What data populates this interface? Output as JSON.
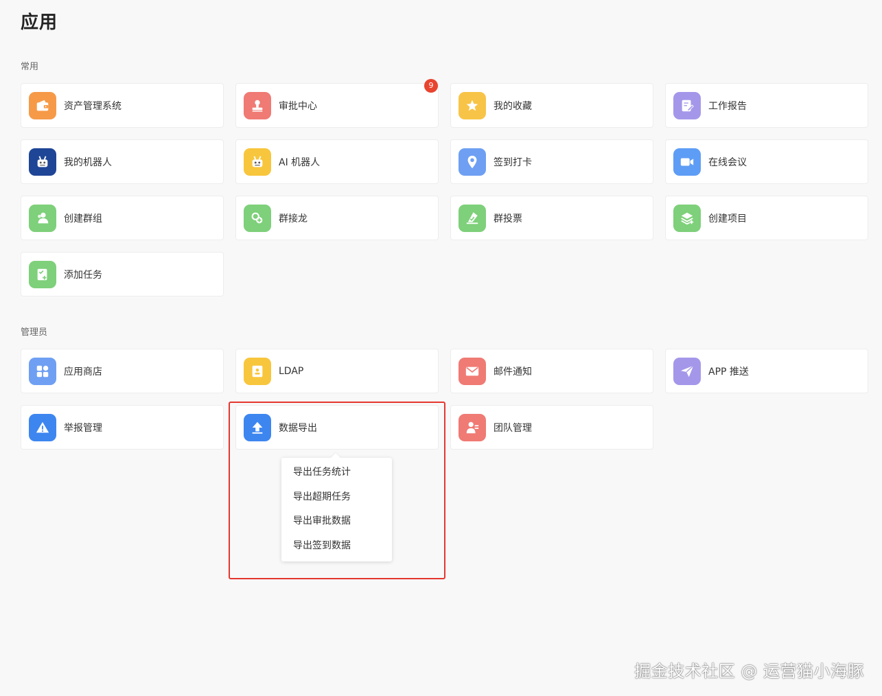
{
  "page": {
    "title": "应用"
  },
  "sections": {
    "common": {
      "label": "常用"
    },
    "admin": {
      "label": "管理员"
    }
  },
  "common_apps": [
    {
      "label": "资产管理系统",
      "icon": "wallet-icon",
      "color": "#f69a48"
    },
    {
      "label": "审批中心",
      "icon": "stamp-icon",
      "color": "#f07a74",
      "badge": "9"
    },
    {
      "label": "我的收藏",
      "icon": "star-icon",
      "color": "#f8c447"
    },
    {
      "label": "工作报告",
      "icon": "report-icon",
      "color": "#a497ea"
    },
    {
      "label": "我的机器人",
      "icon": "robot-icon",
      "color": "#1f4596"
    },
    {
      "label": "AI 机器人",
      "icon": "robot-icon",
      "color": "#f8c63d"
    },
    {
      "label": "签到打卡",
      "icon": "location-pin-icon",
      "color": "#6e9ff3"
    },
    {
      "label": "在线会议",
      "icon": "video-camera-icon",
      "color": "#5e9df5"
    },
    {
      "label": "创建群组",
      "icon": "user-group-icon",
      "color": "#7ed07a"
    },
    {
      "label": "群接龙",
      "icon": "chain-icon",
      "color": "#7ed07a"
    },
    {
      "label": "群投票",
      "icon": "vote-icon",
      "color": "#7ed07a"
    },
    {
      "label": "创建项目",
      "icon": "layers-icon",
      "color": "#7ed07a"
    },
    {
      "label": "添加任务",
      "icon": "task-icon",
      "color": "#7ed07a"
    }
  ],
  "admin_apps": [
    {
      "label": "应用商店",
      "icon": "grid-apps-icon",
      "color": "#6e9ff3"
    },
    {
      "label": "LDAP",
      "icon": "contact-book-icon",
      "color": "#f8c63d"
    },
    {
      "label": "邮件通知",
      "icon": "mail-icon",
      "color": "#f07a74"
    },
    {
      "label": "APP 推送",
      "icon": "send-icon",
      "color": "#a497ea"
    },
    {
      "label": "举报管理",
      "icon": "warning-icon",
      "color": "#3d86f0"
    },
    {
      "label": "数据导出",
      "icon": "upload-icon",
      "color": "#3d86f0"
    },
    {
      "label": "团队管理",
      "icon": "team-icon",
      "color": "#f07a74"
    }
  ],
  "export_menu": {
    "items": [
      "导出任务统计",
      "导出超期任务",
      "导出审批数据",
      "导出签到数据"
    ]
  },
  "watermark": "掘金技术社区 @ 运营猫小海豚"
}
